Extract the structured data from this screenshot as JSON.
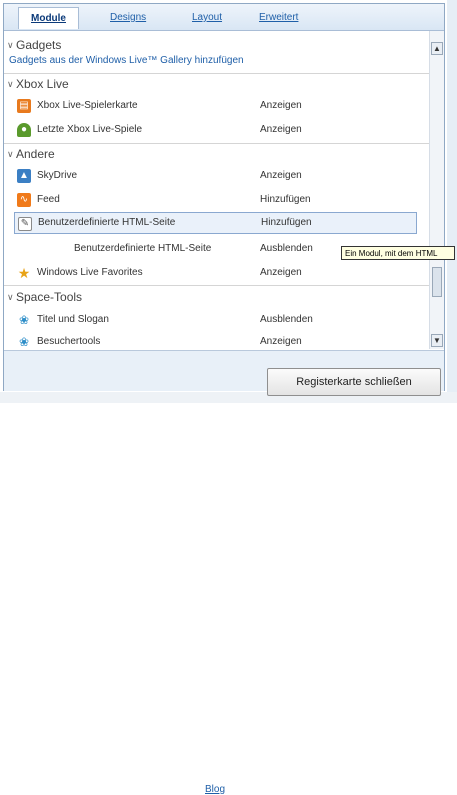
{
  "tabs": [
    {
      "label": "Module",
      "active": true
    },
    {
      "label": "Designs"
    },
    {
      "label": "Layout"
    },
    {
      "label": "Erweitert"
    }
  ],
  "sections": {
    "gadgets": {
      "title": "Gadgets",
      "link": "Gadgets aus der Windows Live™ Gallery hinzufügen"
    },
    "xbox": {
      "title": "Xbox Live",
      "items": [
        {
          "name": "Xbox Live-Spielerkarte",
          "action": "Anzeigen"
        },
        {
          "name": "Letzte Xbox Live-Spiele",
          "action": "Anzeigen"
        }
      ]
    },
    "andere": {
      "title": "Andere",
      "items": [
        {
          "name": "SkyDrive",
          "action": "Anzeigen"
        },
        {
          "name": "Feed",
          "action": "Hinzufügen"
        },
        {
          "name": "Benutzerdefinierte HTML-Seite",
          "action": "Hinzufügen"
        },
        {
          "name": "Benutzerdefinierte HTML-Seite",
          "action": "Ausblenden"
        },
        {
          "name": "Windows Live Favorites",
          "action": "Anzeigen"
        }
      ]
    },
    "space": {
      "title": "Space-Tools",
      "items": [
        {
          "name": "Titel und Slogan",
          "action": "Ausblenden"
        },
        {
          "name": "Besuchertools",
          "action": "Anzeigen"
        }
      ]
    }
  },
  "tooltip": "Ein Modul, mit dem HTML",
  "footer": {
    "close_label": "Registerkarte schließen"
  },
  "background": {
    "link": "Blog"
  },
  "colors": {
    "link": "#1f5fa8",
    "selected_bg": "#eaf1fa",
    "footer_bg": "#e8f0f8"
  },
  "icons": {
    "xbox_card": "xbox-card-icon",
    "xbox_games": "xbox-games-icon",
    "skydrive": "skydrive-icon",
    "feed": "rss-feed-icon",
    "html_page": "html-page-icon",
    "favorites": "favorites-star-icon",
    "title_slogan": "butterfly-icon",
    "visitor_tools": "butterfly-icon"
  }
}
